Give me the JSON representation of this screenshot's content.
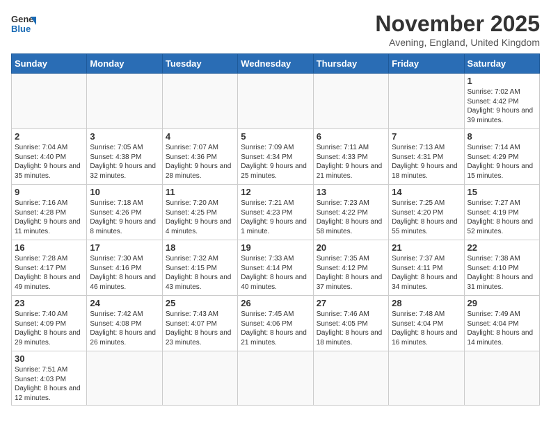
{
  "header": {
    "logo_general": "General",
    "logo_blue": "Blue",
    "month_title": "November 2025",
    "location": "Avening, England, United Kingdom"
  },
  "days_of_week": [
    "Sunday",
    "Monday",
    "Tuesday",
    "Wednesday",
    "Thursday",
    "Friday",
    "Saturday"
  ],
  "weeks": [
    [
      {
        "day": "",
        "info": ""
      },
      {
        "day": "",
        "info": ""
      },
      {
        "day": "",
        "info": ""
      },
      {
        "day": "",
        "info": ""
      },
      {
        "day": "",
        "info": ""
      },
      {
        "day": "",
        "info": ""
      },
      {
        "day": "1",
        "info": "Sunrise: 7:02 AM\nSunset: 4:42 PM\nDaylight: 9 hours and 39 minutes."
      }
    ],
    [
      {
        "day": "2",
        "info": "Sunrise: 7:04 AM\nSunset: 4:40 PM\nDaylight: 9 hours and 35 minutes."
      },
      {
        "day": "3",
        "info": "Sunrise: 7:05 AM\nSunset: 4:38 PM\nDaylight: 9 hours and 32 minutes."
      },
      {
        "day": "4",
        "info": "Sunrise: 7:07 AM\nSunset: 4:36 PM\nDaylight: 9 hours and 28 minutes."
      },
      {
        "day": "5",
        "info": "Sunrise: 7:09 AM\nSunset: 4:34 PM\nDaylight: 9 hours and 25 minutes."
      },
      {
        "day": "6",
        "info": "Sunrise: 7:11 AM\nSunset: 4:33 PM\nDaylight: 9 hours and 21 minutes."
      },
      {
        "day": "7",
        "info": "Sunrise: 7:13 AM\nSunset: 4:31 PM\nDaylight: 9 hours and 18 minutes."
      },
      {
        "day": "8",
        "info": "Sunrise: 7:14 AM\nSunset: 4:29 PM\nDaylight: 9 hours and 15 minutes."
      }
    ],
    [
      {
        "day": "9",
        "info": "Sunrise: 7:16 AM\nSunset: 4:28 PM\nDaylight: 9 hours and 11 minutes."
      },
      {
        "day": "10",
        "info": "Sunrise: 7:18 AM\nSunset: 4:26 PM\nDaylight: 9 hours and 8 minutes."
      },
      {
        "day": "11",
        "info": "Sunrise: 7:20 AM\nSunset: 4:25 PM\nDaylight: 9 hours and 4 minutes."
      },
      {
        "day": "12",
        "info": "Sunrise: 7:21 AM\nSunset: 4:23 PM\nDaylight: 9 hours and 1 minute."
      },
      {
        "day": "13",
        "info": "Sunrise: 7:23 AM\nSunset: 4:22 PM\nDaylight: 8 hours and 58 minutes."
      },
      {
        "day": "14",
        "info": "Sunrise: 7:25 AM\nSunset: 4:20 PM\nDaylight: 8 hours and 55 minutes."
      },
      {
        "day": "15",
        "info": "Sunrise: 7:27 AM\nSunset: 4:19 PM\nDaylight: 8 hours and 52 minutes."
      }
    ],
    [
      {
        "day": "16",
        "info": "Sunrise: 7:28 AM\nSunset: 4:17 PM\nDaylight: 8 hours and 49 minutes."
      },
      {
        "day": "17",
        "info": "Sunrise: 7:30 AM\nSunset: 4:16 PM\nDaylight: 8 hours and 46 minutes."
      },
      {
        "day": "18",
        "info": "Sunrise: 7:32 AM\nSunset: 4:15 PM\nDaylight: 8 hours and 43 minutes."
      },
      {
        "day": "19",
        "info": "Sunrise: 7:33 AM\nSunset: 4:14 PM\nDaylight: 8 hours and 40 minutes."
      },
      {
        "day": "20",
        "info": "Sunrise: 7:35 AM\nSunset: 4:12 PM\nDaylight: 8 hours and 37 minutes."
      },
      {
        "day": "21",
        "info": "Sunrise: 7:37 AM\nSunset: 4:11 PM\nDaylight: 8 hours and 34 minutes."
      },
      {
        "day": "22",
        "info": "Sunrise: 7:38 AM\nSunset: 4:10 PM\nDaylight: 8 hours and 31 minutes."
      }
    ],
    [
      {
        "day": "23",
        "info": "Sunrise: 7:40 AM\nSunset: 4:09 PM\nDaylight: 8 hours and 29 minutes."
      },
      {
        "day": "24",
        "info": "Sunrise: 7:42 AM\nSunset: 4:08 PM\nDaylight: 8 hours and 26 minutes."
      },
      {
        "day": "25",
        "info": "Sunrise: 7:43 AM\nSunset: 4:07 PM\nDaylight: 8 hours and 23 minutes."
      },
      {
        "day": "26",
        "info": "Sunrise: 7:45 AM\nSunset: 4:06 PM\nDaylight: 8 hours and 21 minutes."
      },
      {
        "day": "27",
        "info": "Sunrise: 7:46 AM\nSunset: 4:05 PM\nDaylight: 8 hours and 18 minutes."
      },
      {
        "day": "28",
        "info": "Sunrise: 7:48 AM\nSunset: 4:04 PM\nDaylight: 8 hours and 16 minutes."
      },
      {
        "day": "29",
        "info": "Sunrise: 7:49 AM\nSunset: 4:04 PM\nDaylight: 8 hours and 14 minutes."
      }
    ],
    [
      {
        "day": "30",
        "info": "Sunrise: 7:51 AM\nSunset: 4:03 PM\nDaylight: 8 hours and 12 minutes."
      },
      {
        "day": "",
        "info": ""
      },
      {
        "day": "",
        "info": ""
      },
      {
        "day": "",
        "info": ""
      },
      {
        "day": "",
        "info": ""
      },
      {
        "day": "",
        "info": ""
      },
      {
        "day": "",
        "info": ""
      }
    ]
  ]
}
